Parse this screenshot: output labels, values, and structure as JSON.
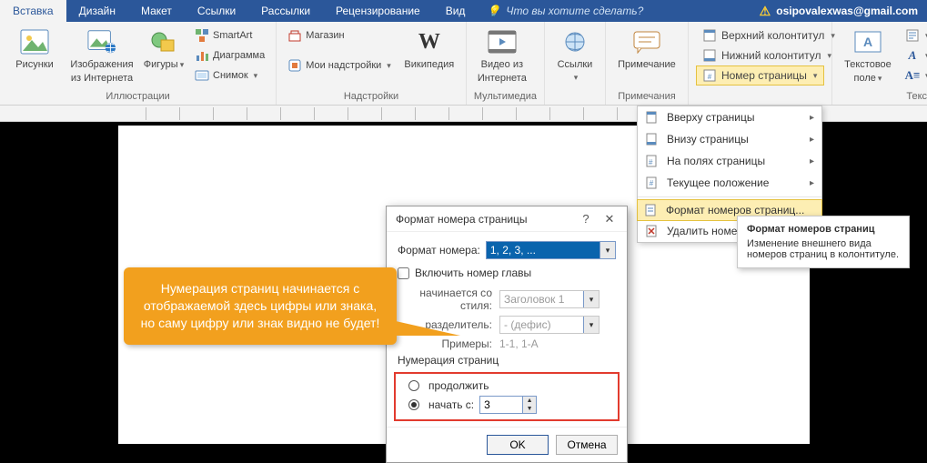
{
  "tabs": {
    "items": [
      "Вставка",
      "Дизайн",
      "Макет",
      "Ссылки",
      "Рассылки",
      "Рецензирование",
      "Вид"
    ],
    "active_index": 0,
    "tellme_placeholder": "Что вы хотите сделать?",
    "account_email": "osipovalexwas@gmail.com"
  },
  "ribbon": {
    "group_illustrations": {
      "label": "Иллюстрации",
      "pictures": "Рисунки",
      "online_pictures_l1": "Изображения",
      "online_pictures_l2": "из Интернета",
      "shapes": "Фигуры",
      "smartart": "SmartArt",
      "chart": "Диаграмма",
      "screenshot": "Снимок"
    },
    "group_addins": {
      "label": "Надстройки",
      "store": "Магазин",
      "my_addins": "Мои надстройки",
      "wikipedia": "Википедия"
    },
    "group_media": {
      "label": "Мультимедиа",
      "video_l1": "Видео из",
      "video_l2": "Интернета"
    },
    "group_links": {
      "links": "Ссылки"
    },
    "group_comments": {
      "label": "Примечания",
      "comment": "Примечание"
    },
    "group_headerfooter": {
      "header": "Верхний колонтитул",
      "footer": "Нижний колонтитул",
      "page_number": "Номер страницы"
    },
    "group_text": {
      "label": "Текст",
      "textbox_l1": "Текстовое",
      "textbox_l2": "поле"
    }
  },
  "menu_page_number": {
    "top": "Вверху страницы",
    "bottom": "Внизу страницы",
    "margins": "На полях страницы",
    "current": "Текущее положение",
    "format": "Формат номеров страниц...",
    "remove": "Удалить номера страниц"
  },
  "tooltip": {
    "title": "Формат номеров страниц",
    "body": "Изменение внешнего вида номеров страниц в колонтитуле."
  },
  "dialog": {
    "title": "Формат номера страницы",
    "format_label": "Формат номера:",
    "format_value": "1, 2, 3, ...",
    "include_chapter": "Включить номер главы",
    "starts_style_label": "начинается со стиля:",
    "starts_style_value": "Заголовок 1",
    "separator_label": "разделитель:",
    "separator_value": "- (дефис)",
    "examples": "Примеры:",
    "examples_value": "1-1, 1-A",
    "numbering_title": "Нумерация страниц",
    "continue": "продолжить",
    "start_at": "начать с:",
    "start_value": "3",
    "ok": "OK",
    "cancel": "Отмена"
  },
  "callout": {
    "text": "Нумерация страниц начинается с отображаемой здесь цифры или знака, но саму цифру или знак видно не будет!"
  }
}
